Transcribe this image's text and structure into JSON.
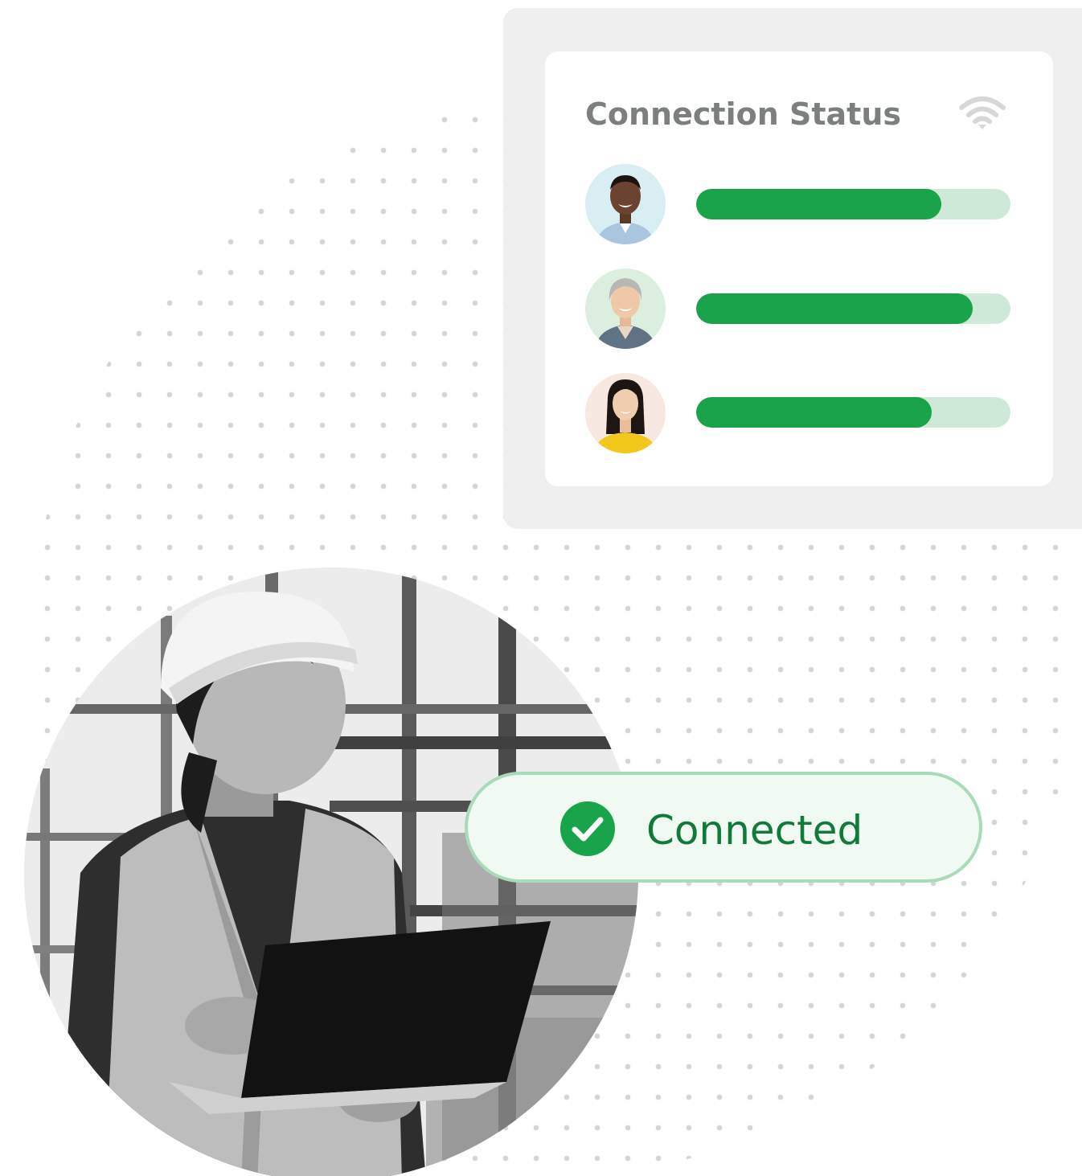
{
  "connection_card": {
    "title": "Connection Status",
    "status_icon": "wifi-icon",
    "users": [
      {
        "avatar": "avatar-man-smiling",
        "signal": 0.78
      },
      {
        "avatar": "avatar-older-woman-smiling",
        "signal": 0.88
      },
      {
        "avatar": "avatar-young-woman-yellow-top",
        "signal": 0.75
      }
    ]
  },
  "badge": {
    "icon": "check-circle-icon",
    "label": "Connected"
  },
  "hero_photo": "worker-with-laptop-photo",
  "colors": {
    "accent_green": "#19a34a",
    "track_green": "#cfe9d8",
    "badge_border": "#a9dbb9",
    "badge_bg": "#f1f9f3",
    "badge_text": "#117a3a",
    "title_gray": "#7b807e",
    "card_bg": "#eeefee"
  }
}
